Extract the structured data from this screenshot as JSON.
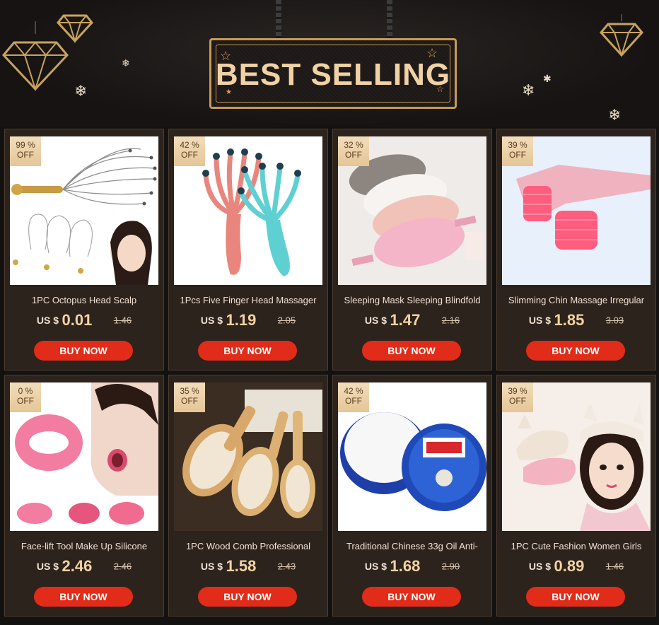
{
  "header": {
    "title": "BEST SELLING",
    "accent_color": "#c69b55",
    "decorations": [
      "diamond-lamp-icon",
      "snowflake-icon",
      "star-icon"
    ]
  },
  "colors": {
    "background": "#141111",
    "card_background": "#2d231d",
    "price_text": "#f2d3a3",
    "buy_button": "#e02c19",
    "badge": "#ead0a6"
  },
  "products": [
    {
      "discount": "99 %",
      "off": "OFF",
      "name": "1PC Octopus Head Scalp",
      "currency": "US $",
      "price": "0.01",
      "old_price": "1.46",
      "buy": "BUY NOW",
      "image_icon": "scalp-massager-icon"
    },
    {
      "discount": "42 %",
      "off": "OFF",
      "name": "1Pcs Five Finger Head Massager",
      "currency": "US $",
      "price": "1.19",
      "old_price": "2.05",
      "buy": "BUY NOW",
      "image_icon": "five-finger-massager-icon"
    },
    {
      "discount": "32 %",
      "off": "OFF",
      "name": "Sleeping Mask Sleeping Blindfold",
      "currency": "US $",
      "price": "1.47",
      "old_price": "2.16",
      "buy": "BUY NOW",
      "image_icon": "sleep-mask-icon"
    },
    {
      "discount": "39 %",
      "off": "OFF",
      "name": "Slimming Chin Massage Irregular",
      "currency": "US $",
      "price": "1.85",
      "old_price": "3.03",
      "buy": "BUY NOW",
      "image_icon": "chin-roller-icon"
    },
    {
      "discount": "0 %",
      "off": "OFF",
      "name": "Face-lift Tool Make Up Silicone",
      "currency": "US $",
      "price": "2.46",
      "old_price": "2.46",
      "buy": "BUY NOW",
      "image_icon": "mouth-trainer-icon"
    },
    {
      "discount": "35 %",
      "off": "OFF",
      "name": "1PC Wood Comb Professional",
      "currency": "US $",
      "price": "1.58",
      "old_price": "2.43",
      "buy": "BUY NOW",
      "image_icon": "wood-comb-icon"
    },
    {
      "discount": "42 %",
      "off": "OFF",
      "name": "Traditional Chinese 33g Oil Anti-",
      "currency": "US $",
      "price": "1.68",
      "old_price": "2.90",
      "buy": "BUY NOW",
      "image_icon": "cream-jar-icon"
    },
    {
      "discount": "39 %",
      "off": "OFF",
      "name": "1PC Cute Fashion Women Girls",
      "currency": "US $",
      "price": "0.89",
      "old_price": "1.46",
      "buy": "BUY NOW",
      "image_icon": "cat-ear-headband-icon"
    }
  ]
}
